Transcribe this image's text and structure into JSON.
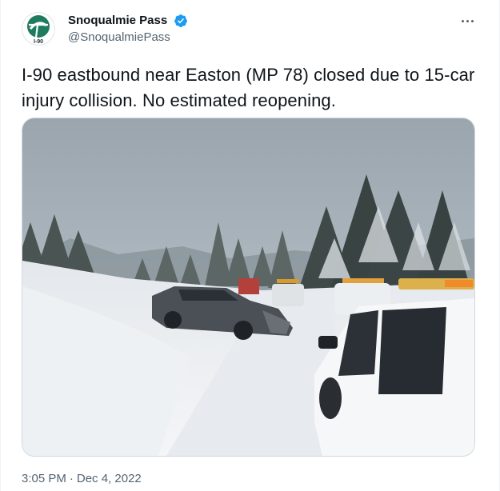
{
  "author": {
    "display_name": "Snoqualmie Pass",
    "handle": "@SnoqualmiePass",
    "verified": true,
    "avatar_label": "I-90",
    "avatar_color": "#1e7b5e"
  },
  "tweet": {
    "text": "I-90 eastbound near Easton (MP 78) closed due to 15-car injury collision. No estimated reopening.",
    "time": "3:05 PM",
    "separator": "·",
    "date": "Dec 4, 2022"
  },
  "media": {
    "icon": "photo",
    "scene_colors": {
      "sky": "#a9b3bb",
      "snow": "#eef0f3",
      "trees": "#3f4a48"
    }
  },
  "colors": {
    "verified_badge": "#1d9bf0",
    "secondary_text": "#536471",
    "primary_text": "#0f1419"
  }
}
